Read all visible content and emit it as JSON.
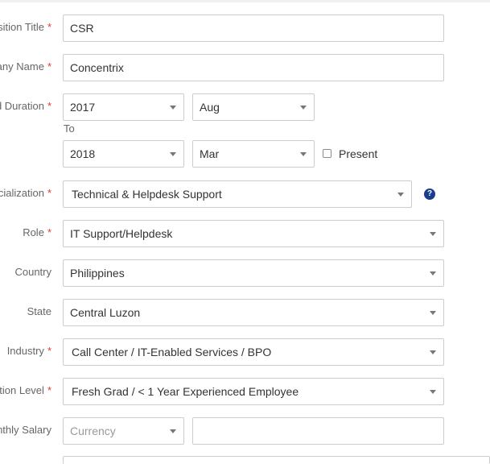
{
  "form": {
    "position_title": {
      "label": "Position Title",
      "value": "CSR"
    },
    "company_name": {
      "label": "Company Name",
      "value": "Concentrix"
    },
    "joined_duration": {
      "label": "Joined Duration",
      "start_year": "2017",
      "start_month": "Aug",
      "to_label": "To",
      "end_year": "2018",
      "end_month": "Mar",
      "present_label": "Present",
      "present_checked": false
    },
    "specialization": {
      "label": "Specialization",
      "value": "Technical & Helpdesk Support",
      "help_icon": "question-circle-icon"
    },
    "role": {
      "label": "Role",
      "value": "IT Support/Helpdesk"
    },
    "country": {
      "label": "Country",
      "value": "Philippines"
    },
    "state": {
      "label": "State",
      "value": "Central Luzon"
    },
    "industry": {
      "label": "Industry",
      "value": "Call Center / IT-Enabled Services / BPO"
    },
    "position_level": {
      "label": "Position Level",
      "value": "Fresh Grad / < 1 Year Experienced Employee"
    },
    "monthly_salary": {
      "label": "Monthly Salary",
      "currency_placeholder": "Currency",
      "amount_value": ""
    }
  },
  "colors": {
    "required": "#e53935",
    "border": "#cccccc",
    "label": "#666666",
    "help_icon": "#1a3d8f"
  }
}
